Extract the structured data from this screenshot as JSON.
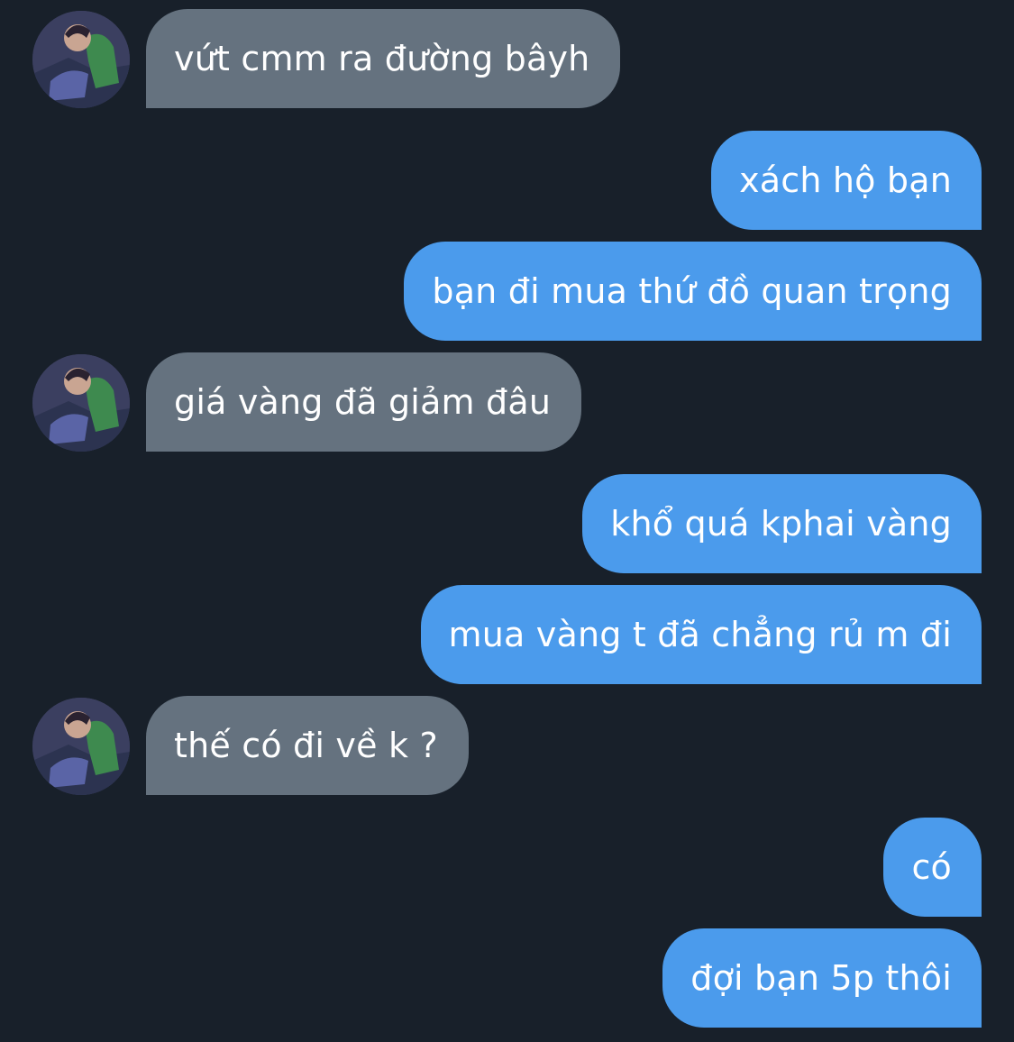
{
  "chat": {
    "messages": [
      {
        "side": "in",
        "text": "vứt cmm ra đường bâyh"
      },
      {
        "side": "out",
        "text": "xách hộ bạn"
      },
      {
        "side": "out",
        "text": "bạn đi mua thứ đồ quan trọng"
      },
      {
        "side": "in",
        "text": "giá vàng đã giảm đâu"
      },
      {
        "side": "out",
        "text": "khổ quá kphai vàng"
      },
      {
        "side": "out",
        "text": "mua vàng t đã chẳng rủ m đi"
      },
      {
        "side": "in",
        "text": "thế có đi về k ?"
      },
      {
        "side": "out",
        "text": "có"
      },
      {
        "side": "out",
        "text": "đợi bạn 5p thôi"
      }
    ]
  },
  "colors": {
    "background": "#18202a",
    "incoming_bubble": "#65727f",
    "outgoing_bubble": "#4b9bec",
    "text": "#ffffff"
  }
}
